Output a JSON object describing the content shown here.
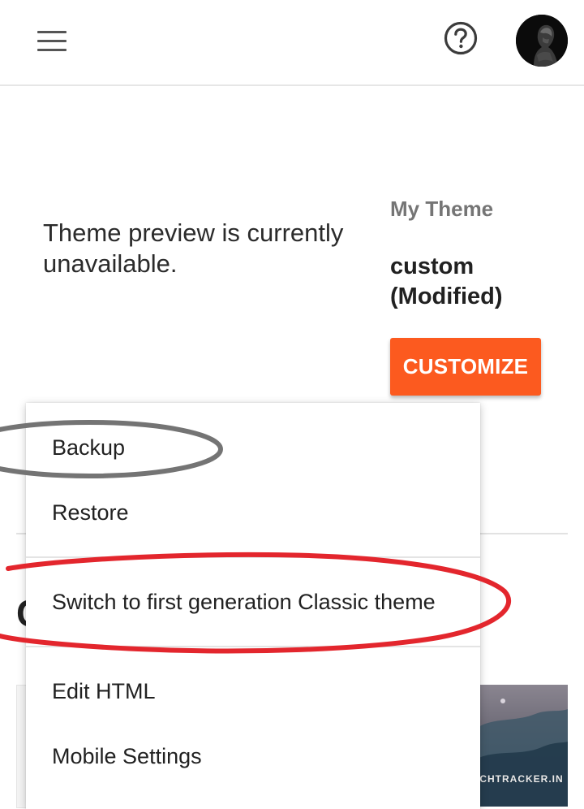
{
  "header": {
    "menu_icon": "hamburger-menu-icon",
    "help_icon": "help-circle-icon",
    "avatar_icon": "user-avatar"
  },
  "preview": {
    "message": "Theme preview is currently unavailable."
  },
  "theme": {
    "section_label": "My Theme",
    "name": "custom (Modified)",
    "customize_label": "CUSTOMIZE"
  },
  "dropdown_menu": {
    "items": [
      {
        "label": "Backup"
      },
      {
        "label": "Restore"
      },
      {
        "label": "Switch to first generation Classic theme"
      },
      {
        "label": "Edit HTML"
      },
      {
        "label": "Mobile Settings"
      }
    ]
  },
  "background": {
    "heading_initial": "C"
  },
  "watermark": {
    "text": "TECHTRACKER.IN"
  },
  "colors": {
    "accent": "#fc5a1f",
    "annotation_red": "#e3262d",
    "annotation_gray": "#747474",
    "label_gray": "#757575",
    "text": "#212121"
  }
}
